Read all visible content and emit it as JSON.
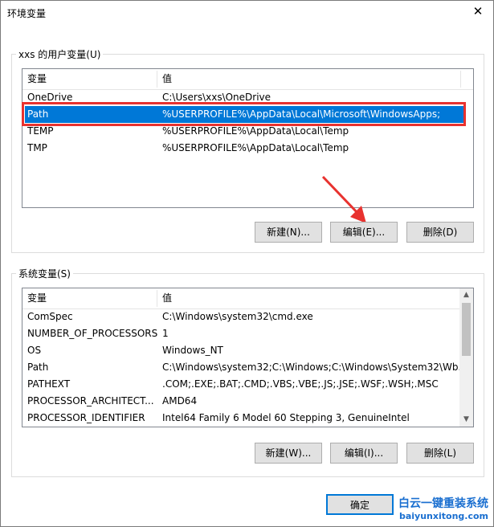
{
  "window": {
    "title": "环境变量",
    "close_glyph": "✕"
  },
  "user_vars": {
    "group_label": "xxs 的用户变量(U)",
    "col_variable": "变量",
    "col_value": "值",
    "rows": [
      {
        "name": "OneDrive",
        "value": "C:\\Users\\xxs\\OneDrive"
      },
      {
        "name": "Path",
        "value": "%USERPROFILE%\\AppData\\Local\\Microsoft\\WindowsApps;"
      },
      {
        "name": "TEMP",
        "value": "%USERPROFILE%\\AppData\\Local\\Temp"
      },
      {
        "name": "TMP",
        "value": "%USERPROFILE%\\AppData\\Local\\Temp"
      }
    ],
    "selected_row": "Path",
    "buttons": {
      "new": "新建(N)...",
      "edit": "编辑(E)...",
      "delete": "删除(D)"
    }
  },
  "system_vars": {
    "group_label": "系统变量(S)",
    "col_variable": "变量",
    "col_value": "值",
    "rows": [
      {
        "name": "ComSpec",
        "value": "C:\\Windows\\system32\\cmd.exe"
      },
      {
        "name": "NUMBER_OF_PROCESSORS",
        "value": "1"
      },
      {
        "name": "OS",
        "value": "Windows_NT"
      },
      {
        "name": "Path",
        "value": "C:\\Windows\\system32;C:\\Windows;C:\\Windows\\System32\\Wb..."
      },
      {
        "name": "PATHEXT",
        "value": ".COM;.EXE;.BAT;.CMD;.VBS;.VBE;.JS;.JSE;.WSF;.WSH;.MSC"
      },
      {
        "name": "PROCESSOR_ARCHITECT...",
        "value": "AMD64"
      },
      {
        "name": "PROCESSOR_IDENTIFIER",
        "value": "Intel64 Family 6 Model 60 Stepping 3, GenuineIntel"
      }
    ],
    "buttons": {
      "new": "新建(W)...",
      "edit": "编辑(I)...",
      "delete": "删除(L)"
    }
  },
  "footer": {
    "ok": "确定"
  },
  "watermark": {
    "line1": "白云一键重装系统",
    "line2": "baiyunxitong.com"
  },
  "colors": {
    "selection": "#0078d7",
    "highlight_box": "#e8322f",
    "arrow": "#e8322f"
  }
}
